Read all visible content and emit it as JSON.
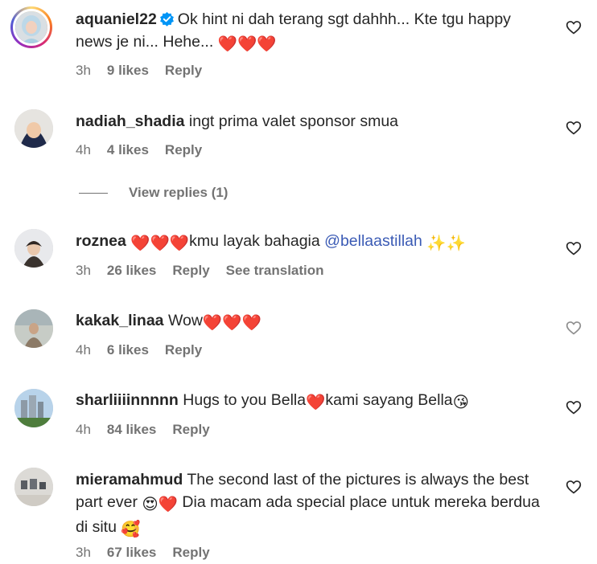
{
  "comments": [
    {
      "username": "aquaniel22",
      "verified": true,
      "text": "Ok hint ni dah terang sgt dahhh... Kte tgu happy news je ni... Hehe...",
      "emoji_suffix": "❤️❤️❤️",
      "time": "3h",
      "likes": "9 likes",
      "reply": "Reply"
    },
    {
      "username": "nadiah_shadia",
      "text": "ingt prima valet sponsor smua",
      "time": "4h",
      "likes": "4 likes",
      "reply": "Reply",
      "view_replies": "View replies (1)"
    },
    {
      "username": "roznea",
      "pre_emoji": "❤️❤️❤️",
      "text": "kmu layak bahagia",
      "mention": "@bellaastillah",
      "post_emoji": "✨✨",
      "time": "3h",
      "likes": "26 likes",
      "reply": "Reply",
      "translation": "See translation"
    },
    {
      "username": "kakak_linaa",
      "text": "Wow",
      "post_emoji": "❤️❤️❤️",
      "time": "4h",
      "likes": "6 likes",
      "reply": "Reply"
    },
    {
      "username": "sharliiiinnnnn",
      "text_a": "Hugs to you Bella",
      "mid_emoji": "❤️",
      "text_b": "kami sayang Bella",
      "post_emoji": "😘",
      "time": "4h",
      "likes": "84 likes",
      "reply": "Reply"
    },
    {
      "username": "mieramahmud",
      "text_a": "The second last of the pictures is always the best part ever",
      "mid_emoji": "😍❤️",
      "text_b": "Dia macam ada special place untuk mereka berdua di situ",
      "post_emoji": "🥰",
      "time": "3h",
      "likes": "67 likes",
      "reply": "Reply"
    }
  ],
  "colors": {
    "text": "#262626",
    "muted": "#737373",
    "mention": "#3b5bb5",
    "verified": "#0095f6"
  }
}
